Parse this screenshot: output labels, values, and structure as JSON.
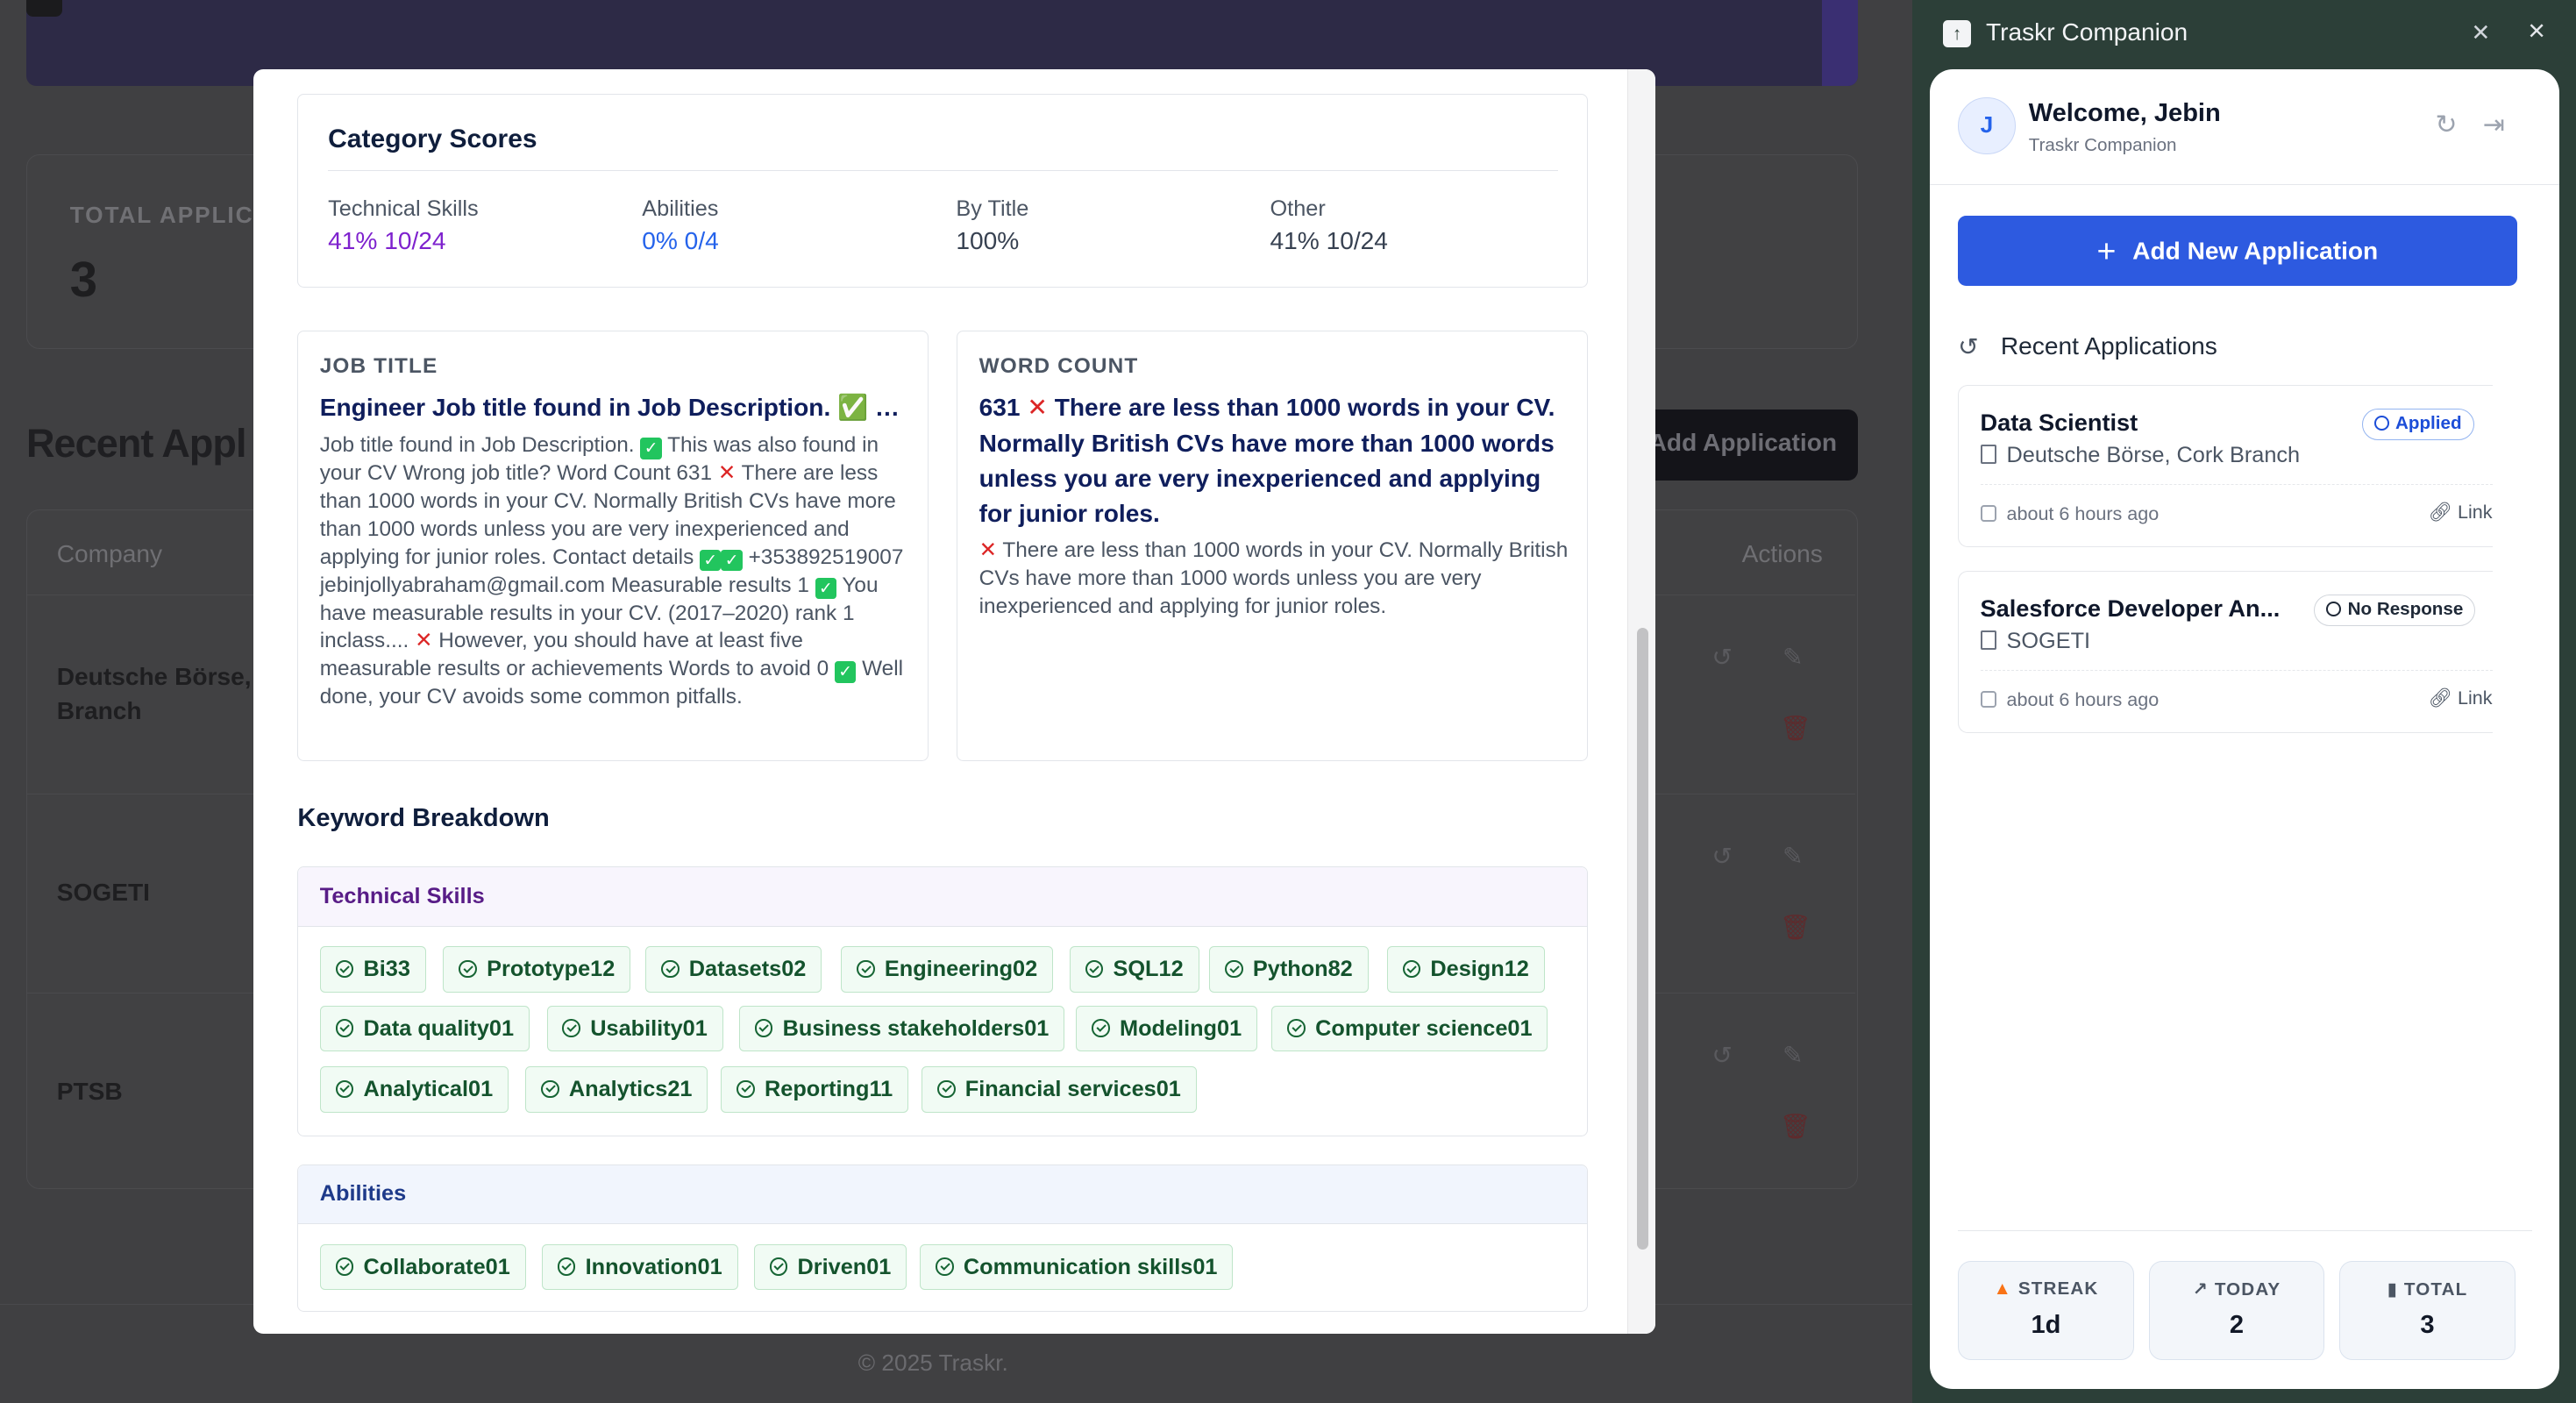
{
  "background": {
    "total_label": "TOTAL APPLIC",
    "total_value": "3",
    "recent_heading": "Recent Appl",
    "add_button": "Add Application",
    "col_company": "Company",
    "col_actions": "Actions",
    "rows": [
      {
        "company": "Deutsche Börse, Branch"
      },
      {
        "company": "SOGETI"
      },
      {
        "company": "PTSB"
      }
    ],
    "footer": "© 2025 Traskr."
  },
  "modal": {
    "category_scores": {
      "title": "Category Scores",
      "columns": [
        {
          "label": "Technical Skills",
          "value": "41% 10/24"
        },
        {
          "label": "Abilities",
          "value": "0% 0/4"
        },
        {
          "label": "By Title",
          "value": "100%"
        },
        {
          "label": "Other",
          "value": "41% 10/24"
        }
      ]
    },
    "job_title": {
      "heading": "JOB TITLE",
      "title_text": "Engineer Job title found in Job Description. ✅ T...",
      "body": [
        "Job title found in Job Description.",
        "This was also found in your CV Wrong job title? Word Count 631",
        "There are less than 1000 words in your CV. Normally British CVs have more than 1000 words unless you are very inexperienced and applying for junior roles. Contact details",
        "+353892519007 jebinjollyabraham@gmail.com Measurable results 1",
        "You have measurable results in your CV. (2017–2020) rank 1 inclass....",
        "However, you should have at least five measurable results or achievements Words to avoid 0",
        "Well done, your CV avoids some common pitfalls."
      ]
    },
    "word_count": {
      "heading": "WORD COUNT",
      "title_number": "631",
      "title_text": "There are less than 1000 words in your CV. Normally British CVs have more than 1000 words unless you are very inexperienced and applying for junior roles.",
      "body": "There are less than 1000 words in your CV. Normally British CVs have more than 1000 words unless you are very inexperienced and applying for junior roles."
    },
    "keyword_breakdown": {
      "title": "Keyword Breakdown",
      "technical_heading": "Technical Skills",
      "technical": [
        "Bi33",
        "Prototype12",
        "Datasets02",
        "Engineering02",
        "SQL12",
        "Python82",
        "Design12",
        "Data quality01",
        "Usability01",
        "Business stakeholders01",
        "Modeling01",
        "Computer science01",
        "Analytical01",
        "Analytics21",
        "Reporting11",
        "Financial services01"
      ],
      "abilities_heading": "Abilities",
      "abilities": [
        "Collaborate01",
        "Innovation01",
        "Driven01",
        "Communication skills01"
      ]
    }
  },
  "side": {
    "window_title": "Traskr Companion",
    "avatar_initial": "J",
    "welcome": "Welcome, Jebin",
    "welcome_sub": "Traskr Companion",
    "add_button": "Add New Application",
    "recent_title": "Recent Applications",
    "apps": [
      {
        "title": "Data Scientist",
        "status": "Applied",
        "company": "Deutsche Börse, Cork Branch",
        "time": "about 6 hours ago",
        "link": "Link"
      },
      {
        "title": "Salesforce Developer An...",
        "status": "No Response",
        "company": "SOGETI",
        "time": "about 6 hours ago",
        "link": "Link"
      }
    ],
    "stats": [
      {
        "label": "STREAK",
        "value": "1d",
        "icon": "flame-icon"
      },
      {
        "label": "TODAY",
        "value": "2",
        "icon": "trending-up-icon"
      },
      {
        "label": "TOTAL",
        "value": "3",
        "icon": "bar-chart-icon"
      }
    ],
    "colors": {
      "primary": "#2d5ae0",
      "frame": "#2c3f38"
    }
  }
}
